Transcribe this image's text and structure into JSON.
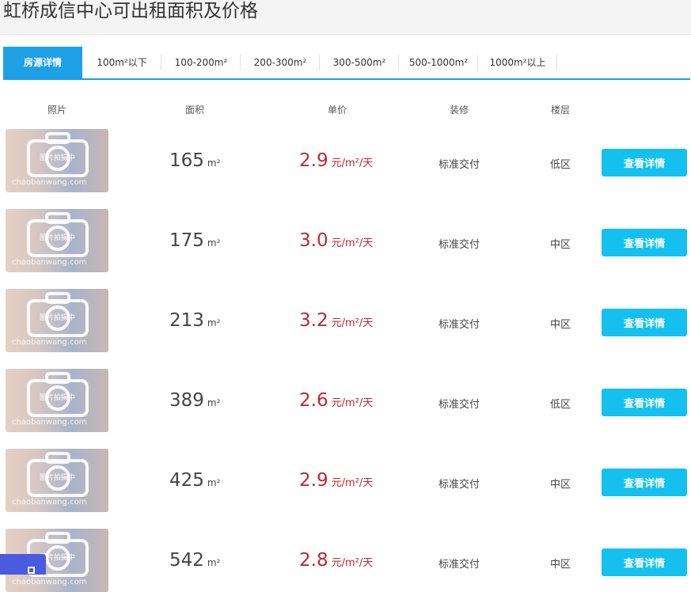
{
  "page": {
    "title": "虹桥成信中心可出租面积及价格"
  },
  "tabs": [
    {
      "label": "房源详情",
      "active": true
    },
    {
      "label": "100m²以下"
    },
    {
      "label": "100-200m²"
    },
    {
      "label": "200-300m²"
    },
    {
      "label": "300-500m²"
    },
    {
      "label": "500-1000m²"
    },
    {
      "label": "1000m²以上"
    }
  ],
  "table": {
    "headers": {
      "photo": "照片",
      "area": "面积",
      "price": "单价",
      "decor": "装修",
      "floor": "楼层"
    },
    "area_unit": "m²",
    "price_unit": "元/m²/天",
    "placeholder_text": "图片拍摄中",
    "placeholder_site": "chaobanwang.com",
    "detail_label": "查看详情",
    "rows": [
      {
        "area": "165",
        "price": "2.9",
        "decor": "标准交付",
        "floor": "低区"
      },
      {
        "area": "175",
        "price": "3.0",
        "decor": "标准交付",
        "floor": "中区"
      },
      {
        "area": "213",
        "price": "3.2",
        "decor": "标准交付",
        "floor": "中区"
      },
      {
        "area": "389",
        "price": "2.6",
        "decor": "标准交付",
        "floor": "低区"
      },
      {
        "area": "425",
        "price": "2.9",
        "decor": "标准交付",
        "floor": "中区"
      },
      {
        "area": "542",
        "price": "2.8",
        "decor": "标准交付",
        "floor": "中区"
      }
    ]
  },
  "colors": {
    "accent": "#1ea0e6",
    "button": "#14c1ee",
    "price": "#c0272d"
  }
}
